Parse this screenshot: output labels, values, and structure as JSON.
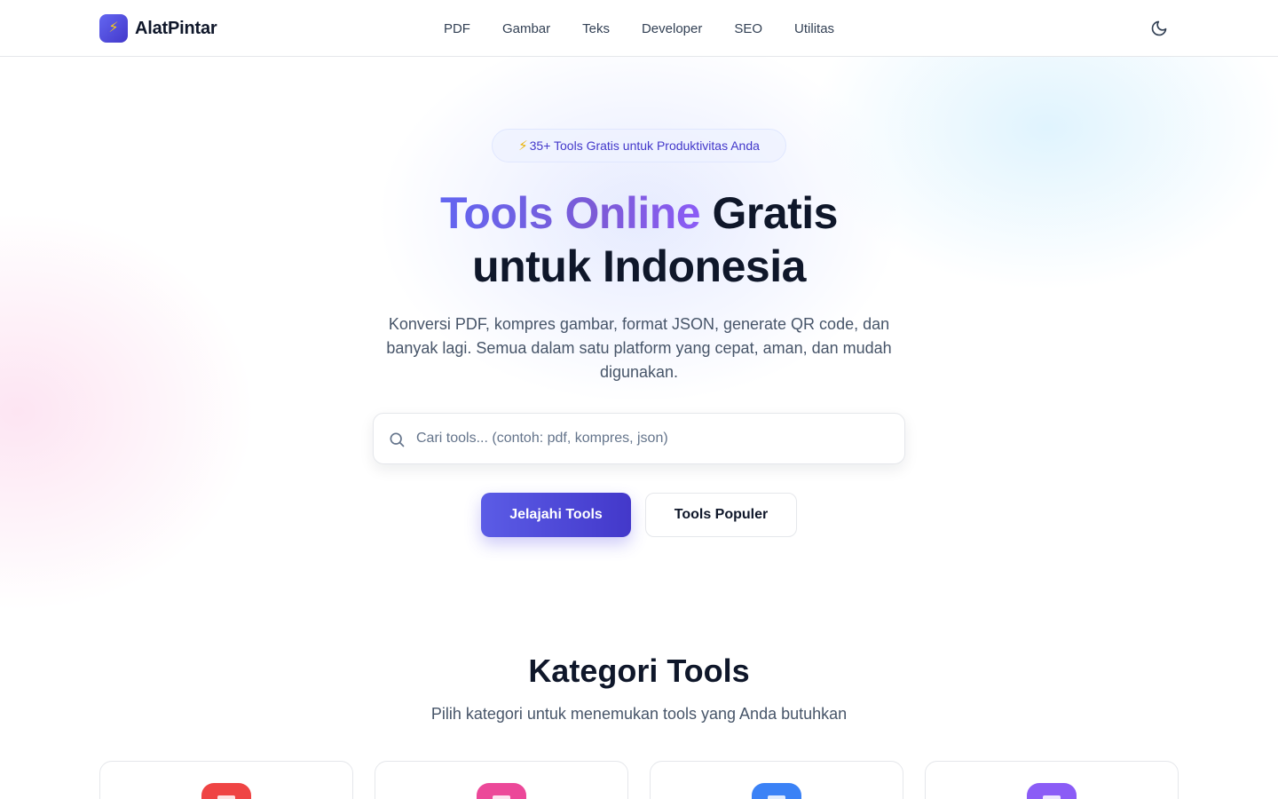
{
  "app": {
    "name": "AlatPintar",
    "logo_icon": "lightning-icon"
  },
  "nav": {
    "items": [
      {
        "label": "PDF"
      },
      {
        "label": "Gambar"
      },
      {
        "label": "Teks"
      },
      {
        "label": "Developer"
      },
      {
        "label": "SEO"
      },
      {
        "label": "Utilitas"
      }
    ],
    "theme_toggle_icon": "moon-icon"
  },
  "hero": {
    "badge_icon": "⚡",
    "badge_text": "35+ Tools Gratis untuk Produktivitas Anda",
    "title_highlight": "Tools Online",
    "title_rest_line1": "Gratis",
    "title_line2": "untuk Indonesia",
    "subtitle": "Konversi PDF, kompres gambar, format JSON, generate QR code, dan banyak lagi. Semua dalam satu platform yang cepat, aman, dan mudah digunakan.",
    "search": {
      "placeholder": "Cari tools... (contoh: pdf, kompres, json)",
      "value": ""
    },
    "primary_button": "Jelajahi Tools",
    "secondary_button": "Tools Populer"
  },
  "categories": {
    "title": "Kategori Tools",
    "subtitle": "Pilih kategori untuk menemukan tools yang Anda butuhkan",
    "cards": [
      {
        "icon": "pdf-icon",
        "color": "#ef4444"
      },
      {
        "icon": "image-icon",
        "color": "#ec4899"
      },
      {
        "icon": "text-icon",
        "color": "#3b82f6"
      },
      {
        "icon": "code-icon",
        "color": "#8b5cf6"
      }
    ]
  },
  "colors": {
    "accent": "#4f46e5",
    "gradient_start": "#6366f1",
    "gradient_end": "#8b5cf6"
  }
}
